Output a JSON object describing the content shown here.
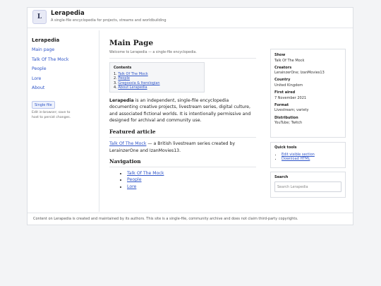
{
  "header": {
    "logo_letter": "L",
    "title": "Lerapedia",
    "tagline": "A single-file encyclopedia for projects, streams and worldbuilding"
  },
  "sidebar": {
    "heading": "Lerapedia",
    "items": [
      {
        "label": "Main page"
      },
      {
        "label": "Talk Of The Mock"
      },
      {
        "label": "People"
      },
      {
        "label": "Lore"
      },
      {
        "label": "About"
      }
    ],
    "badge": "Single file",
    "note": "Edit in-browser; save to host to persist changes."
  },
  "main": {
    "title": "Main Page",
    "welcome": "Welcome to Lerapedia — a single-file encyclopedia.",
    "toc": {
      "heading": "Contents",
      "items": [
        {
          "num": "1.",
          "label": "Talk Of The Mock"
        },
        {
          "num": "2.",
          "label": "People"
        },
        {
          "num": "3.",
          "label": "Gregoxxia & Iterologian"
        },
        {
          "num": "4.",
          "label": "About Lerapedia"
        }
      ]
    },
    "intro": {
      "bold": "Lerapedia",
      "text": " is an independent, single-file encyclopedia documenting creative projects, livestream series, digital culture, and associated fictional worlds. It is intentionally permissive and designed for archival and community use."
    },
    "featured": {
      "heading": "Featured article",
      "link": "Talk Of The Mock",
      "text": " — a British livestream series created by LerainzerOne and IzanMovies13."
    },
    "navigation": {
      "heading": "Navigation",
      "items": [
        {
          "label": "Talk Of The Mock"
        },
        {
          "label": "People"
        },
        {
          "label": "Lore"
        }
      ]
    }
  },
  "infobox": {
    "rows": [
      {
        "label": "Show",
        "value": "Talk Of The Mock"
      },
      {
        "label": "Creators",
        "value": "LerainzerOne; IzanMovies13"
      },
      {
        "label": "Country",
        "value": "United Kingdom"
      },
      {
        "label": "First aired",
        "value": "7 November 2021"
      },
      {
        "label": "Format",
        "value": "Livestream; variety"
      },
      {
        "label": "Distribution",
        "value": "YouTube; Twitch"
      }
    ]
  },
  "quick_tools": {
    "heading": "Quick tools",
    "items": [
      {
        "label": "Edit visible section"
      },
      {
        "label": "Download HTML"
      }
    ]
  },
  "search": {
    "heading": "Search",
    "placeholder": "Search Lerapedia"
  },
  "footer": {
    "text": "Content on Lerapedia is created and maintained by its authors. This site is a single-file, community archive and does not claim third-party copyrights."
  }
}
